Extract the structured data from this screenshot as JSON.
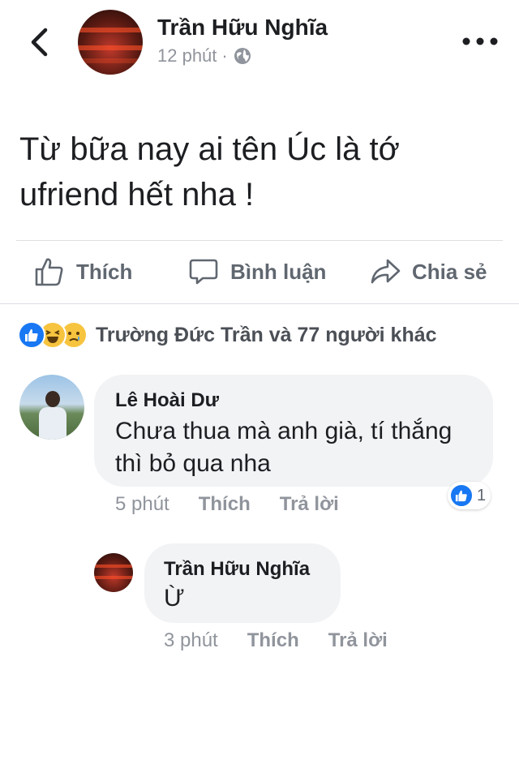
{
  "post": {
    "author": "Trần Hữu Nghĩa",
    "time": "12 phút",
    "separator": "·",
    "audience_icon": "globe-icon",
    "text": "Từ bữa nay ai tên Úc là tớ ufriend hết nha !"
  },
  "actions": {
    "like": "Thích",
    "comment": "Bình luận",
    "share": "Chia sẻ"
  },
  "reactions": {
    "icons": [
      "like-icon",
      "haha-icon",
      "sad-icon"
    ],
    "summary": "Trường Đức Trần và 77 người khác"
  },
  "comments": [
    {
      "author": "Lê Hoài Dư",
      "text": "Chưa thua mà anh già, tí thắng thì bỏ qua nha",
      "time": "5 phút",
      "like_label": "Thích",
      "reply_label": "Trả lời",
      "like_count": "1"
    },
    {
      "author": "Trần Hữu Nghĩa",
      "text": "Ừ",
      "time": "3 phút",
      "like_label": "Thích",
      "reply_label": "Trả lời"
    }
  ],
  "colors": {
    "accent": "#1877f2",
    "muted_text": "#90949c",
    "bubble_bg": "#f2f3f5"
  }
}
